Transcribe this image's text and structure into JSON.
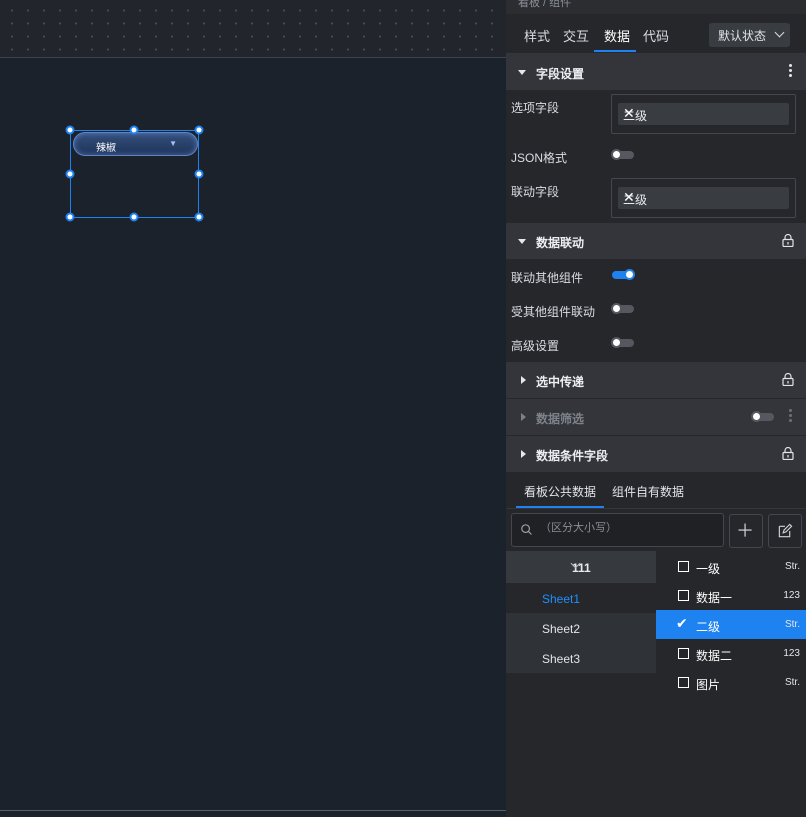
{
  "panel": {
    "breadcrumb": "看板 / 组件",
    "tabs": [
      "样式",
      "交互",
      "数据",
      "代码"
    ],
    "active_tab": "数据",
    "state_select": "默认状态"
  },
  "canvas": {
    "widget_label": "辣椒"
  },
  "field_settings": {
    "title": "字段设置",
    "option_field_label": "选项字段",
    "option_field_value": "二级",
    "json_label": "JSON格式",
    "link_field_label": "联动字段",
    "link_field_value": "二级"
  },
  "data_linkage": {
    "title": "数据联动",
    "link_others_label": "联动其他组件",
    "linked_by_others_label": "受其他组件联动",
    "advanced_label": "高级设置"
  },
  "sections": {
    "selected_pass": "选中传递",
    "data_filter": "数据筛选",
    "condition_fields": "数据条件字段"
  },
  "data_source": {
    "tabs": [
      "看板公共数据",
      "组件自有数据"
    ],
    "search_placeholder": "（区分大小写）",
    "group_name": "111",
    "sheets": [
      "Sheet1",
      "Sheet2",
      "Sheet3"
    ],
    "fields": [
      {
        "name": "一级",
        "type": "Str."
      },
      {
        "name": "数据一",
        "type": "123"
      },
      {
        "name": "二级",
        "type": "Str."
      },
      {
        "name": "数据二",
        "type": "123"
      },
      {
        "name": "图片",
        "type": "Str."
      }
    ]
  }
}
